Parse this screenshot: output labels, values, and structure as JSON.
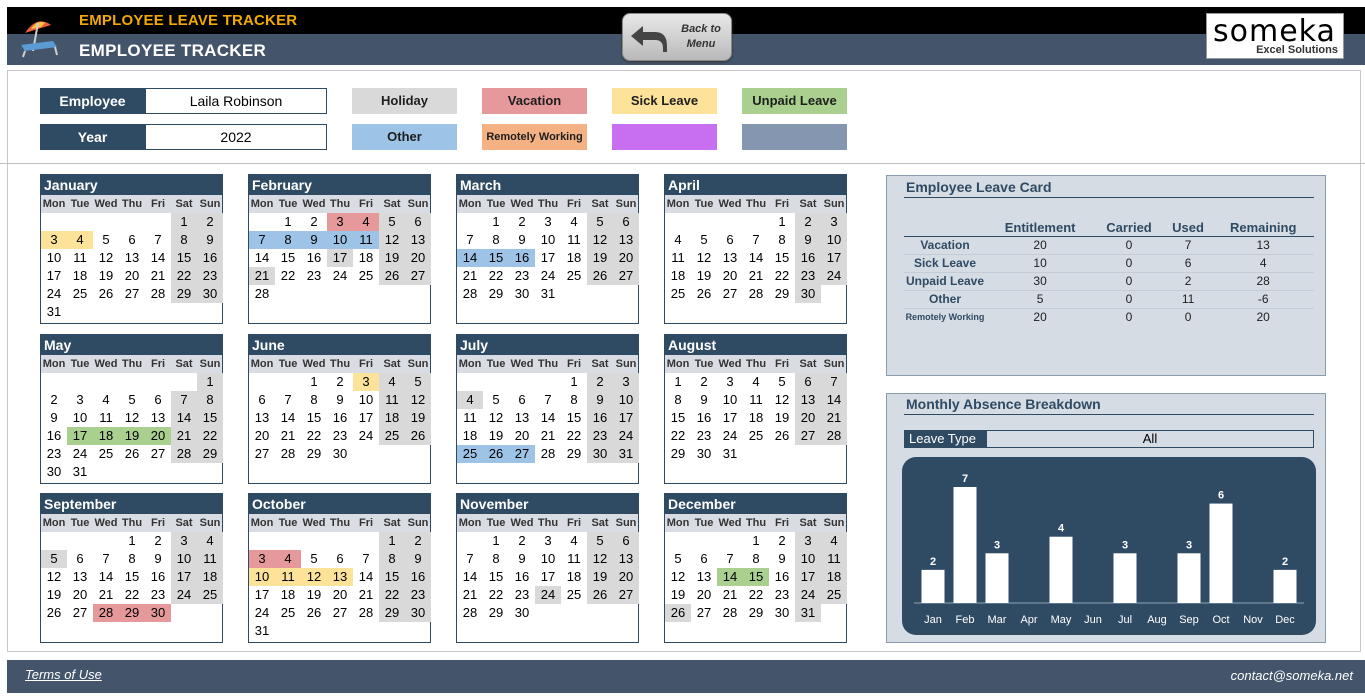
{
  "header": {
    "app_title": "EMPLOYEE LEAVE TRACKER",
    "page_title": "EMPLOYEE TRACKER",
    "back_button": "Back to Menu",
    "brand_name": "someka",
    "brand_sub": "Excel Solutions"
  },
  "filters": {
    "employee_label": "Employee",
    "employee_value": "Laila Robinson",
    "year_label": "Year",
    "year_value": "2022"
  },
  "legend": [
    {
      "label": "Holiday",
      "color": "#d9d9d9"
    },
    {
      "label": "Vacation",
      "color": "#e6999b"
    },
    {
      "label": "Sick Leave",
      "color": "#fde299"
    },
    {
      "label": "Unpaid Leave",
      "color": "#a9d08e"
    },
    {
      "label": "Other",
      "color": "#9dc3e6"
    },
    {
      "label": "Remotely Working",
      "color": "#f4b183"
    },
    {
      "label": "",
      "color": "#c86ef0"
    },
    {
      "label": "",
      "color": "#8496b0"
    }
  ],
  "weekdays": [
    "Mon",
    "Tue",
    "Wed",
    "Thu",
    "Fri",
    "Sat",
    "Sun"
  ],
  "months": [
    {
      "name": "January",
      "offset": 5,
      "days": 31,
      "marks": {
        "3": "sick",
        "4": "sick"
      }
    },
    {
      "name": "February",
      "offset": 1,
      "days": 28,
      "marks": {
        "3": "vac",
        "4": "vac",
        "7": "oth",
        "8": "oth",
        "9": "oth",
        "10": "oth",
        "11": "oth",
        "17": "hol",
        "21": "hol"
      }
    },
    {
      "name": "March",
      "offset": 1,
      "days": 31,
      "marks": {
        "14": "oth",
        "15": "oth",
        "16": "oth"
      }
    },
    {
      "name": "April",
      "offset": 4,
      "days": 30,
      "marks": {}
    },
    {
      "name": "May",
      "offset": 6,
      "days": 31,
      "marks": {
        "17": "unp",
        "18": "unp",
        "19": "unp",
        "20": "unp"
      }
    },
    {
      "name": "June",
      "offset": 2,
      "days": 30,
      "marks": {
        "3": "sick",
        "4": "hol"
      }
    },
    {
      "name": "July",
      "offset": 4,
      "days": 31,
      "marks": {
        "4": "hol",
        "25": "oth",
        "26": "oth",
        "27": "oth"
      }
    },
    {
      "name": "August",
      "offset": 0,
      "days": 31,
      "marks": {}
    },
    {
      "name": "September",
      "offset": 3,
      "days": 30,
      "marks": {
        "5": "hol",
        "28": "vac",
        "29": "vac",
        "30": "vac"
      }
    },
    {
      "name": "October",
      "offset": 5,
      "days": 31,
      "marks": {
        "3": "vac",
        "4": "vac",
        "10": "sick",
        "11": "sick",
        "12": "sick",
        "13": "sick"
      }
    },
    {
      "name": "November",
      "offset": 1,
      "days": 30,
      "marks": {
        "24": "hol"
      }
    },
    {
      "name": "December",
      "offset": 3,
      "days": 31,
      "marks": {
        "14": "unp",
        "15": "unp",
        "26": "hol"
      }
    }
  ],
  "leave_card": {
    "title": "Employee Leave Card",
    "columns": [
      "",
      "Entitlement",
      "Carried",
      "Used",
      "Remaining"
    ],
    "rows": [
      {
        "label": "Vacation",
        "entitlement": "20",
        "carried": "0",
        "used": "7",
        "remaining": "13"
      },
      {
        "label": "Sick Leave",
        "entitlement": "10",
        "carried": "0",
        "used": "6",
        "remaining": "4"
      },
      {
        "label": "Unpaid Leave",
        "entitlement": "30",
        "carried": "0",
        "used": "2",
        "remaining": "28"
      },
      {
        "label": "Other",
        "entitlement": "5",
        "carried": "0",
        "used": "11",
        "remaining": "-6"
      },
      {
        "label": "Remotely Working",
        "entitlement": "20",
        "carried": "0",
        "used": "0",
        "remaining": "20"
      }
    ]
  },
  "breakdown": {
    "title": "Monthly Absence Breakdown",
    "leave_type_label": "Leave Type",
    "leave_type_value": "All"
  },
  "chart_data": {
    "type": "bar",
    "categories": [
      "Jan",
      "Feb",
      "Mar",
      "Apr",
      "May",
      "Jun",
      "Jul",
      "Aug",
      "Sep",
      "Oct",
      "Nov",
      "Dec"
    ],
    "values": [
      2,
      7,
      3,
      0,
      4,
      0,
      3,
      0,
      3,
      6,
      0,
      2
    ],
    "title": "Monthly Absence Breakdown",
    "ylim": [
      0,
      7
    ],
    "grid": false
  },
  "footer": {
    "terms": "Terms of Use",
    "contact": "contact@someka.net"
  }
}
